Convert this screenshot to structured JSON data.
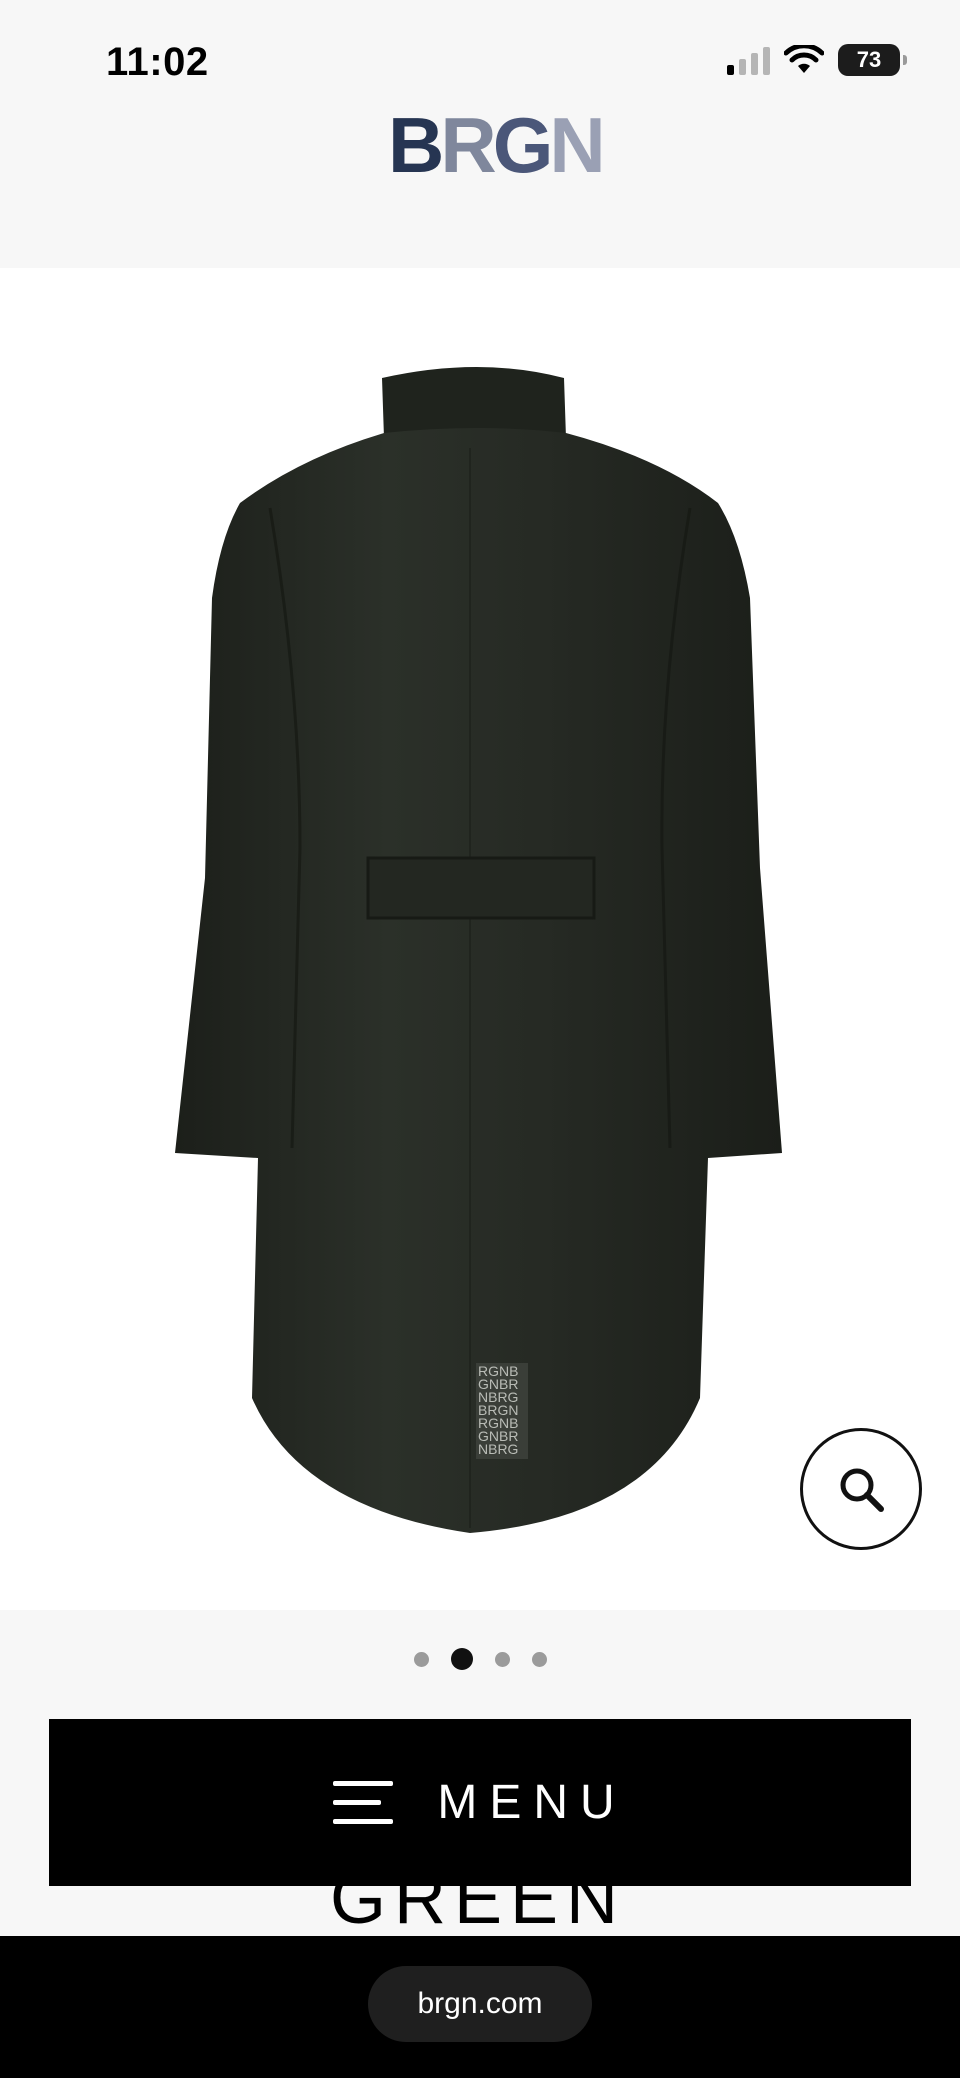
{
  "status_bar": {
    "time": "11:02",
    "battery_level": "73",
    "signal_bars_active": 1,
    "signal_bars_total": 4
  },
  "header": {
    "logo_text": "BRGN",
    "logo_colors": [
      "#263552",
      "#7f879c",
      "#4b5779",
      "#9aa0b4"
    ]
  },
  "product": {
    "image_icon": "coat-back-view",
    "coat_color": "#262a24",
    "back_label_lines": [
      "RGNB",
      "GNBR",
      "NBRG",
      "BRGN",
      "RGNB",
      "GNBR",
      "NBRG"
    ],
    "zoom_icon": "search-icon"
  },
  "carousel": {
    "total_slides": 4,
    "active_slide": 2
  },
  "menu": {
    "label": "MENU",
    "icon": "hamburger-icon"
  },
  "product_title_partial": "GREEN",
  "browser": {
    "url": "brgn.com"
  }
}
